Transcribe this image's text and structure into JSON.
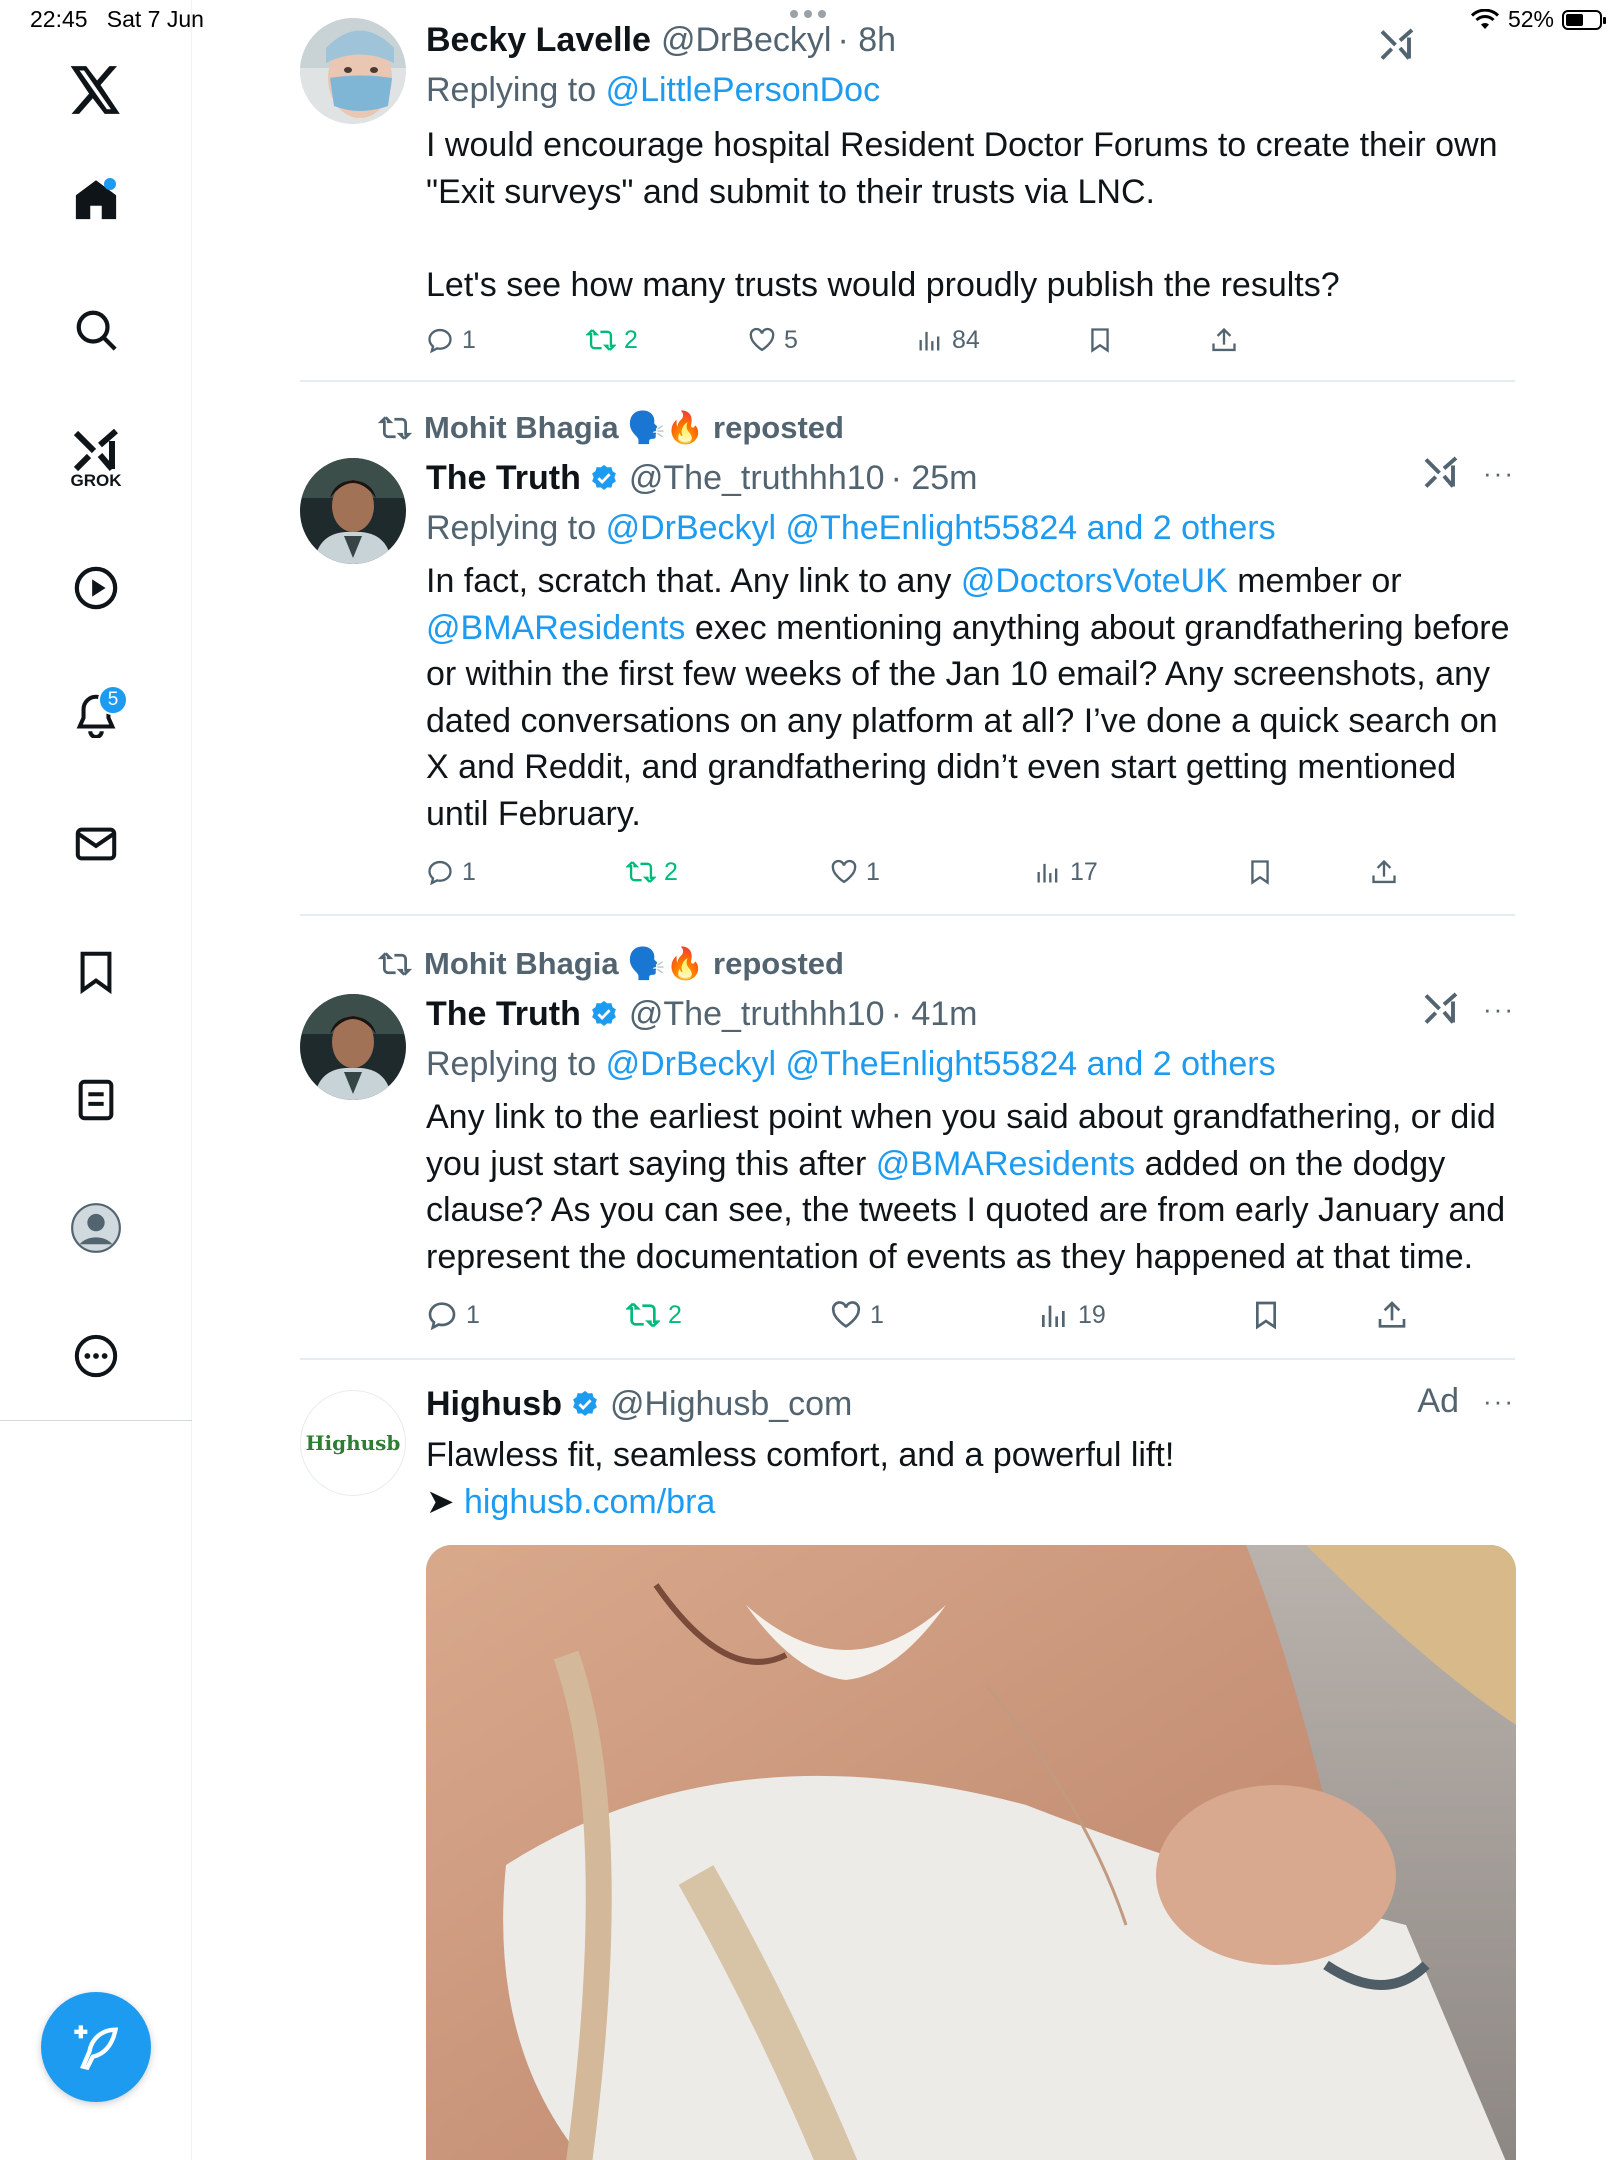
{
  "status_bar": {
    "time": "22:45",
    "date": "Sat 7 Jun",
    "battery": "52%",
    "battery_level": 0.52
  },
  "sidebar": {
    "grok_label": "GROK",
    "notifications_count": "5"
  },
  "tweets": [
    {
      "name": "Becky Lavelle",
      "handle": "@DrBeckyl",
      "time": "· 8h",
      "replying_prefix": "Replying to",
      "replying_to": "@LittlePersonDoc",
      "text": "I would encourage hospital Resident Doctor Forums to create their own \"Exit  surveys\" and submit to their trusts via LNC.\n\nLet's see how many trusts would proudly publish the results?",
      "replies": "1",
      "reposts": "2",
      "likes": "5",
      "views": "84"
    },
    {
      "repost_by": "Mohit Bhagia 🗣️🔥 reposted",
      "name": "The Truth",
      "handle": "@The_truthhh10",
      "time": "· 25m",
      "replying_prefix": "Replying to",
      "replying_to": "@DrBeckyl @TheEnlight55824 and 2 others",
      "text_parts": [
        "In fact, scratch that. Any link to any ",
        "@DoctorsVoteUK",
        " member or ",
        "@BMAResidents",
        " exec mentioning anything about grandfathering before or within the first few weeks of the Jan 10 email? Any screenshots, any dated conversations on any platform at all? I’ve done a quick search on X and Reddit, and grandfathering didn’t even start getting mentioned until February."
      ],
      "replies": "1",
      "reposts": "2",
      "likes": "1",
      "views": "17"
    },
    {
      "repost_by": "Mohit Bhagia 🗣️🔥 reposted",
      "name": "The Truth",
      "handle": "@The_truthhh10",
      "time": "· 41m",
      "replying_prefix": "Replying to",
      "replying_to": "@DrBeckyl @TheEnlight55824 and 2 others",
      "text_parts": [
        "Any link to the earliest point when you said about grandfathering, or did you just start saying this after ",
        "@BMAResidents",
        " added on the dodgy clause? As you can see, the tweets I quoted are from early January and represent the documentation of events as they happened at that time."
      ],
      "replies": "1",
      "reposts": "2",
      "likes": "1",
      "views": "19"
    }
  ],
  "ad": {
    "name": "Highusb",
    "handle": "@Highusb_com",
    "ad_label": "Ad",
    "logo_text": "Highusb",
    "text": "Flawless fit, seamless comfort, and a powerful lift!",
    "arrow": "➤",
    "link": "highusb.com/bra"
  },
  "colors": {
    "accent": "#1d9bf0",
    "repost_green": "#00ba7c",
    "secondary_text": "#536471",
    "ad_logo_green": "#2e7d32"
  }
}
